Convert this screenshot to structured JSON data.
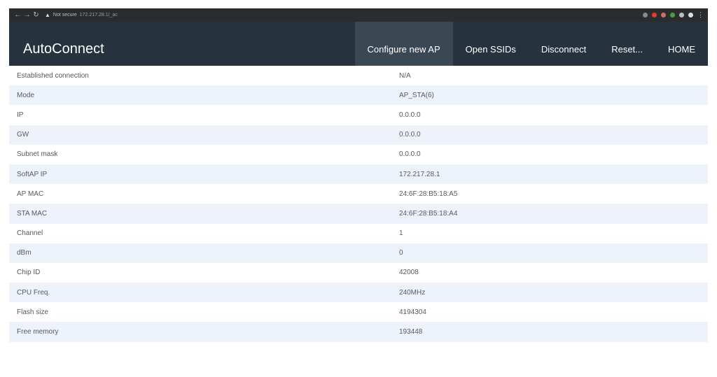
{
  "browser": {
    "security_label": "Not secure",
    "url": "172.217.28.1/_ac",
    "colors": {
      "chrome_bg": "#2b2c2e"
    }
  },
  "app": {
    "brand": "AutoConnect",
    "nav": [
      {
        "label": "Configure new AP",
        "active": true
      },
      {
        "label": "Open SSIDs"
      },
      {
        "label": "Disconnect"
      },
      {
        "label": "Reset..."
      },
      {
        "label": "HOME"
      }
    ],
    "colors": {
      "header_bg": "#26333e",
      "active_nav_bg": "#3a4854",
      "stripe": "#eef3fb"
    }
  },
  "status_table": [
    {
      "key": "Established connection",
      "value": "N/A"
    },
    {
      "key": "Mode",
      "value": "AP_STA(6)"
    },
    {
      "key": "IP",
      "value": "0.0.0.0"
    },
    {
      "key": "GW",
      "value": "0.0.0.0"
    },
    {
      "key": "Subnet mask",
      "value": "0.0.0.0"
    },
    {
      "key": "SoftAP IP",
      "value": "172.217.28.1"
    },
    {
      "key": "AP MAC",
      "value": "24:6F:28:B5:18:A5"
    },
    {
      "key": "STA MAC",
      "value": "24:6F:28:B5:18:A4"
    },
    {
      "key": "Channel",
      "value": "1"
    },
    {
      "key": "dBm",
      "value": "0"
    },
    {
      "key": "Chip ID",
      "value": "42008"
    },
    {
      "key": "CPU Freq.",
      "value": "240MHz"
    },
    {
      "key": "Flash size",
      "value": "4194304"
    },
    {
      "key": "Free memory",
      "value": "193448"
    }
  ]
}
